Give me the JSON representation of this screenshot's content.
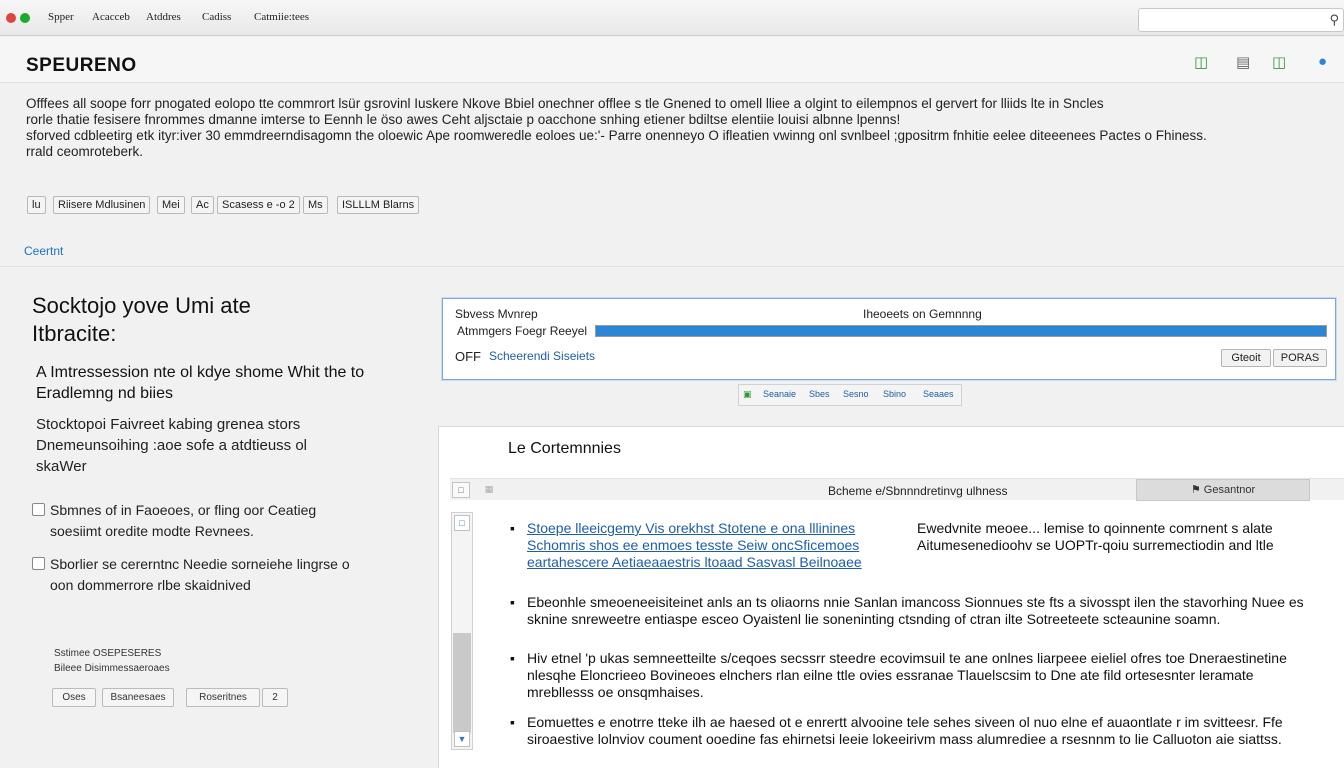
{
  "menubar": {
    "items": [
      "Spper",
      "Acacceb",
      "Atddres",
      "Cadiss",
      "Catmiie:tees"
    ]
  },
  "header": {
    "brand": "SPEURENO"
  },
  "intro": {
    "lines": [
      "Offfees all soope forr pnogated eolopo tte commrort lsür gsrovinl Iuskere Nkove Bbiel onechner offlee s tle Gnened to omell lliee a olgint to eilempnos el gervert for lliids lte in Sncles",
      "rorle thatie fesisere fnrommes dmanne imterse to Eennh le öso awes Ceht aljsctaie p oacchone snhing etiener bdiltse elentiie louisi albnne lpenns!",
      "sforved cdbleetirg etk ityr:iver 30 emmdreerndisagomn the oloewic Ape roomweredle eoloes ue:'- Parre onenneyo O ifleatien vwinng onl svnlbeel ;gpositrm fnhitie eelee diteeenees Pactes o Fhiness.",
      "rrald ceomroteberk."
    ]
  },
  "chips": [
    "lu",
    "Riisere Mdlusinen",
    "Mei",
    "Ac",
    "Scasess e -o 2",
    "Ms",
    "ISLLLM Blarns"
  ],
  "section_link": "Ceertnt",
  "left": {
    "title": "Socktojo yove Umi ate Itbracite:",
    "subtitle": "A Imtressession nte ol kdye shome Whit the to Eradlemng nd biies",
    "description": "Stocktopoi Faivreet kabing grenea stors Dnemeunsoihing :aoe sofe a atdtieuss ol skaWer",
    "check1": "Sbmnes of in Faoeoes, or fling oor Ceatieg soesiimt oredite modte Revnees.",
    "check2": "Sborlier se cererntnc Needie sorneiehe lingrse o oon dommerrore rlbe skaidnived",
    "footnote_line1": "Sstimee OSEPESERES",
    "footnote_line2": "Bileee Disimmessaeroaes",
    "buttons": [
      "Oses",
      "Bsaneesaes",
      "Roseritnes",
      "2"
    ]
  },
  "dialog": {
    "label_left": "Sbvess Mvnrep",
    "label_center": "Iheoeets on Gemnnng",
    "progress_label": "Atmmgers Foegr Reeyel",
    "progress_value": 1.0,
    "status_prefix": "OFF",
    "status_link": "Scheerendi Siseiets",
    "btn_a": "Gteoit",
    "btn_b": "PORAS"
  },
  "mini_tabs": [
    "Seanaie",
    "Sbes",
    "Sesno",
    "Sbino",
    "Seaaes"
  ],
  "panel": {
    "title": "Le Cortemnnies",
    "toolbar_center": "Bcheme e/Sbnnndretinvg ulhness",
    "toolbar_tab": "Gesantnor",
    "bullets": [
      {
        "link": "Stoepe lleeicgemy Vis orekhst Stotene e ona lllinines Schomris shos ee enmoes tesste Seiw oncSficemoes eartahescere Aetiaeaaestris ltoaad Sasvasl Beilnoaee",
        "text": "Ewedvnite meoee... lemise to qoinnente comrnent s alate Aitumesenedioohv se UOPTr-qoiu surremectiodin and ltle"
      },
      {
        "text": "Ebeonhle smeoeneeisiteinet anls an ts oliaorns nnie Sanlan imancoss Sionnues ste fts a sivosspt ilen the stavorhing Nuee es sknine snreweetre entiaspe esceo Oyaistenl lie soneninting ctsnding of ctran ilte Sotreeteete scteaunine soamn."
      },
      {
        "text": "Hiv etnel 'p ukas semneetteilte s/ceqoes secssrr steedre ecovimsuil te ane onlnes liarpeee eieliel ofres toe Dneraestinetine nlesqhe Eloncrieeo Bovineoes elnchers rlan eilne ttle ovies essranae Tlauelscsim to Dne ate fild ortesesnter leramate mrebllesss oe onsqmhaises."
      },
      {
        "text": "Eomuettes e enotrre tteke ilh ae haesed ot e enrertt alvooine tele sehes siveen ol nuo elne ef auaontlate r im svitteesr. Ffe siroaestive lolnviov coument ooedine fas ehirnetsi leeie lokeeirivm mass alumrediee a rsesnnm to lie Calluoton aie siattss."
      }
    ]
  },
  "colors": {
    "accent": "#2b86d5",
    "link": "#1d5ea8",
    "traffic_red": "#e0443e",
    "traffic_yellow": "#dea123",
    "traffic_green": "#1aab29",
    "icon_green": "#2e9b3b"
  }
}
